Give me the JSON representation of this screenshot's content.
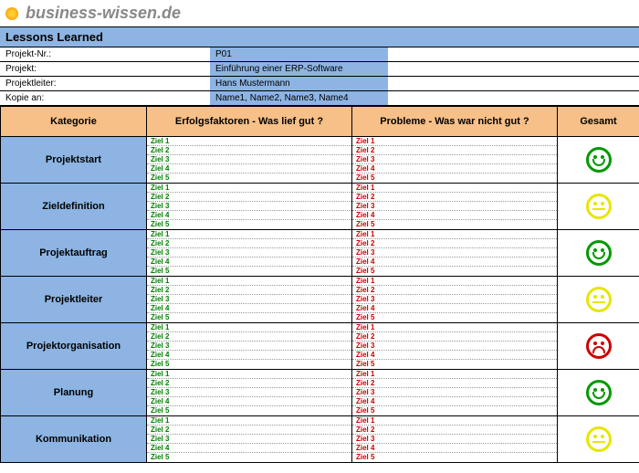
{
  "brand": "business-wissen.de",
  "title": "Lessons Learned",
  "meta": [
    {
      "label": "Projekt-Nr.:",
      "value": "P01"
    },
    {
      "label": "Projekt:",
      "value": "Einführung einer ERP-Software"
    },
    {
      "label": "Projektleiter:",
      "value": "Hans Mustermann"
    },
    {
      "label": "Kopie an:",
      "value": "Name1, Name2, Name3, Name4"
    }
  ],
  "headers": {
    "kategorie": "Kategorie",
    "erfolg": "Erfolgsfaktoren - Was lief gut ?",
    "probleme": "Probleme - Was war nicht gut ?",
    "gesamt": "Gesamt"
  },
  "ziele": [
    "Ziel 1",
    "Ziel 2",
    "Ziel 3",
    "Ziel 4",
    "Ziel 5"
  ],
  "rows": [
    {
      "kategorie": "Projektstart",
      "smiley": "green"
    },
    {
      "kategorie": "Zieldefinition",
      "smiley": "yellow"
    },
    {
      "kategorie": "Projektauftrag",
      "smiley": "green"
    },
    {
      "kategorie": "Projektleiter",
      "smiley": "yellow"
    },
    {
      "kategorie": "Projektorganisation",
      "smiley": "red"
    },
    {
      "kategorie": "Planung",
      "smiley": "green"
    },
    {
      "kategorie": "Kommunikation",
      "smiley": "yellow"
    }
  ]
}
